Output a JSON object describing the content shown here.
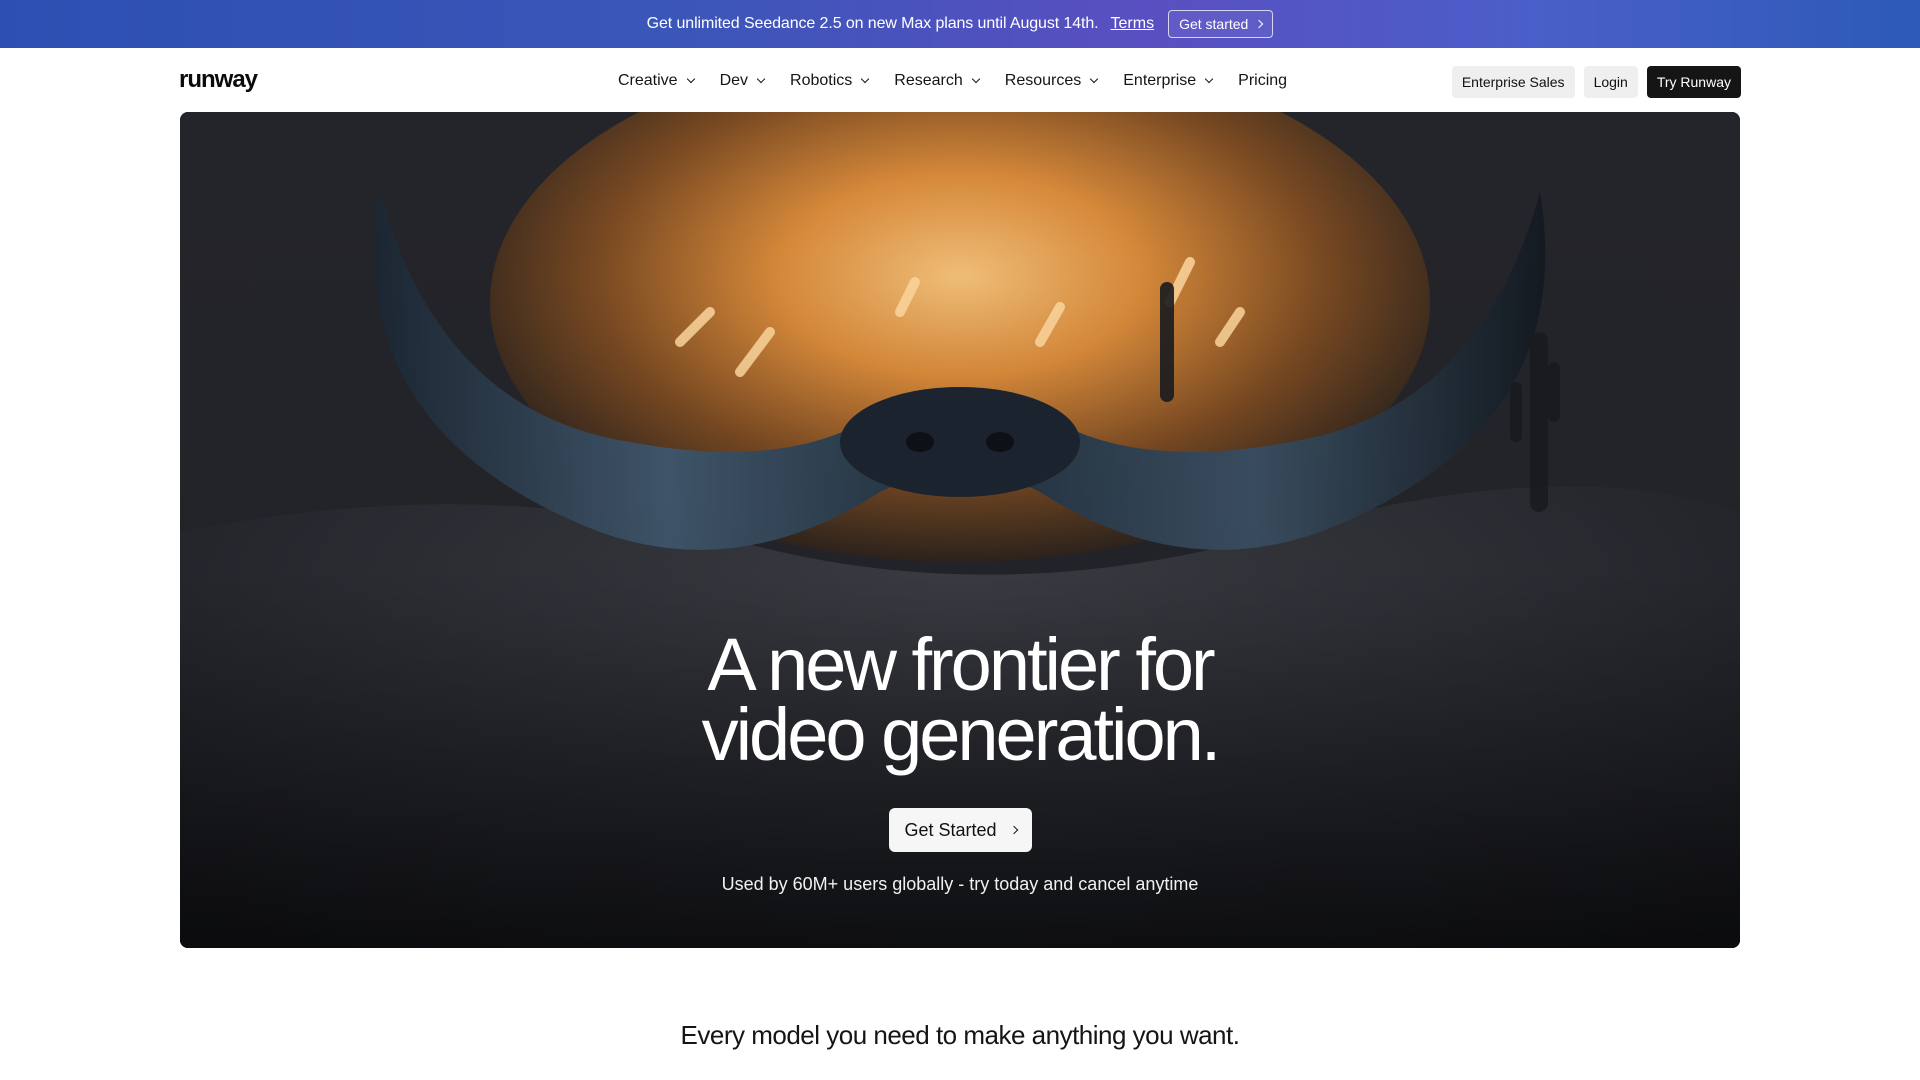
{
  "promo": {
    "text": "Get unlimited Seedance 2.5 on new Max plans until August 14th.",
    "terms_label": "Terms",
    "cta_label": "Get started"
  },
  "nav": {
    "logo": "runway",
    "items": [
      {
        "label": "Creative",
        "has_dropdown": true
      },
      {
        "label": "Dev",
        "has_dropdown": true
      },
      {
        "label": "Robotics",
        "has_dropdown": true
      },
      {
        "label": "Research",
        "has_dropdown": true
      },
      {
        "label": "Resources",
        "has_dropdown": true
      },
      {
        "label": "Enterprise",
        "has_dropdown": true
      },
      {
        "label": "Pricing",
        "has_dropdown": false
      }
    ],
    "enterprise_sales_label": "Enterprise Sales",
    "login_label": "Login",
    "try_label": "Try Runway"
  },
  "hero": {
    "title_line1": "A new frontier for",
    "title_line2": "video generation.",
    "cta_label": "Get Started",
    "subtitle": "Used by 60M+ users globally - try today and cancel anytime"
  },
  "section": {
    "title": "Every model you need to make anything you want."
  },
  "colors": {
    "promo_gradient_start": "#2d4fb3",
    "promo_gradient_mid": "#5a4fc2",
    "dark_button": "#151515",
    "light_button": "#efefef"
  }
}
